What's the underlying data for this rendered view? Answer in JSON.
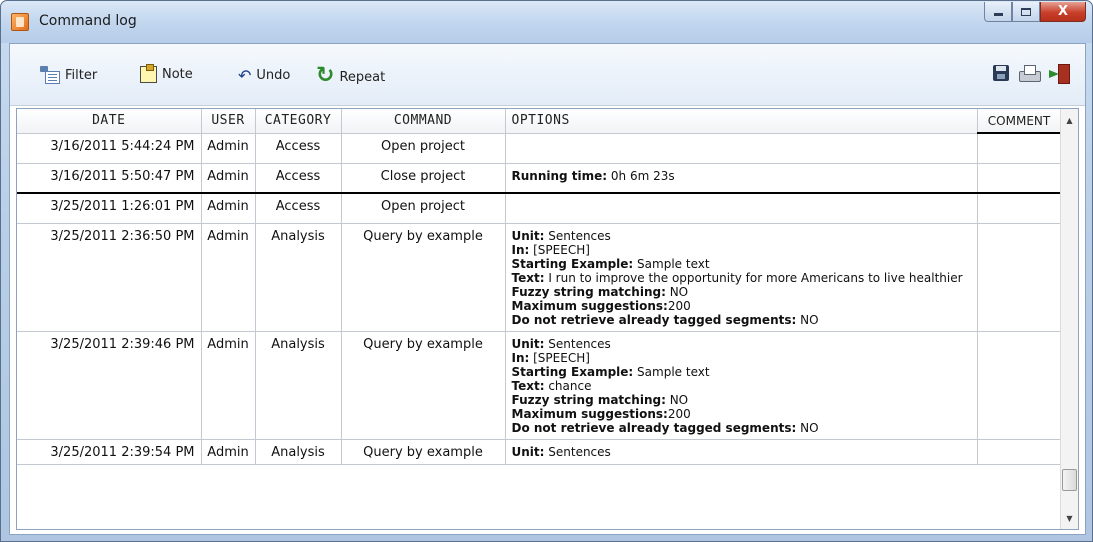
{
  "window": {
    "title": "Command log",
    "min_label": "",
    "max_label": "",
    "close_label": "X"
  },
  "toolbar": {
    "filter": "Filter",
    "note": "Note",
    "undo": "Undo",
    "repeat": "Repeat",
    "icons": [
      "filter-icon",
      "note-icon",
      "undo-icon",
      "repeat-icon",
      "save-icon",
      "print-icon",
      "exit-icon"
    ]
  },
  "columns": [
    "DATE",
    "USER",
    "CATEGORY",
    "COMMAND",
    "OPTIONS",
    "COMMENT"
  ],
  "rows": [
    {
      "date": "3/16/2011 5:44:24 PM",
      "user": "Admin",
      "category": "Access",
      "command": "Open project",
      "options": [],
      "comment": ""
    },
    {
      "date": "3/16/2011 5:50:47 PM",
      "user": "Admin",
      "category": "Access",
      "command": "Close project",
      "options": [
        {
          "k": "Running time:",
          "v": " 0h 6m 23s"
        }
      ],
      "comment": ""
    },
    {
      "date": "3/25/2011 1:26:01 PM",
      "user": "Admin",
      "category": "Access",
      "command": "Open project",
      "options": [],
      "comment": ""
    },
    {
      "date": "3/25/2011 2:36:50 PM",
      "user": "Admin",
      "category": "Analysis",
      "command": "Query by example",
      "options": [
        {
          "k": "Unit:",
          "v": " Sentences"
        },
        {
          "k": "In:",
          "v": " [SPEECH]"
        },
        {
          "k": "Starting Example:",
          "v": " Sample text"
        },
        {
          "k": "Text:",
          "v": " I run to improve the opportunity for more Americans to live healthier"
        },
        {
          "k": "Fuzzy string matching:",
          "v": " NO"
        },
        {
          "k": "Maximum suggestions:",
          "v": "200"
        },
        {
          "k": "Do not retrieve already tagged segments:",
          "v": " NO"
        }
      ],
      "comment": ""
    },
    {
      "date": "3/25/2011 2:39:46 PM",
      "user": "Admin",
      "category": "Analysis",
      "command": "Query by example",
      "options": [
        {
          "k": "Unit:",
          "v": " Sentences"
        },
        {
          "k": "In:",
          "v": " [SPEECH]"
        },
        {
          "k": "Starting Example:",
          "v": " Sample text"
        },
        {
          "k": "Text:",
          "v": " chance"
        },
        {
          "k": "Fuzzy string matching:",
          "v": " NO"
        },
        {
          "k": "Maximum suggestions:",
          "v": "200"
        },
        {
          "k": "Do not retrieve already tagged segments:",
          "v": " NO"
        }
      ],
      "comment": ""
    },
    {
      "date": "3/25/2011 2:39:54 PM",
      "user": "Admin",
      "category": "Analysis",
      "command": "Query by example",
      "options": [
        {
          "k": "Unit:",
          "v": " Sentences"
        }
      ],
      "comment": ""
    }
  ]
}
